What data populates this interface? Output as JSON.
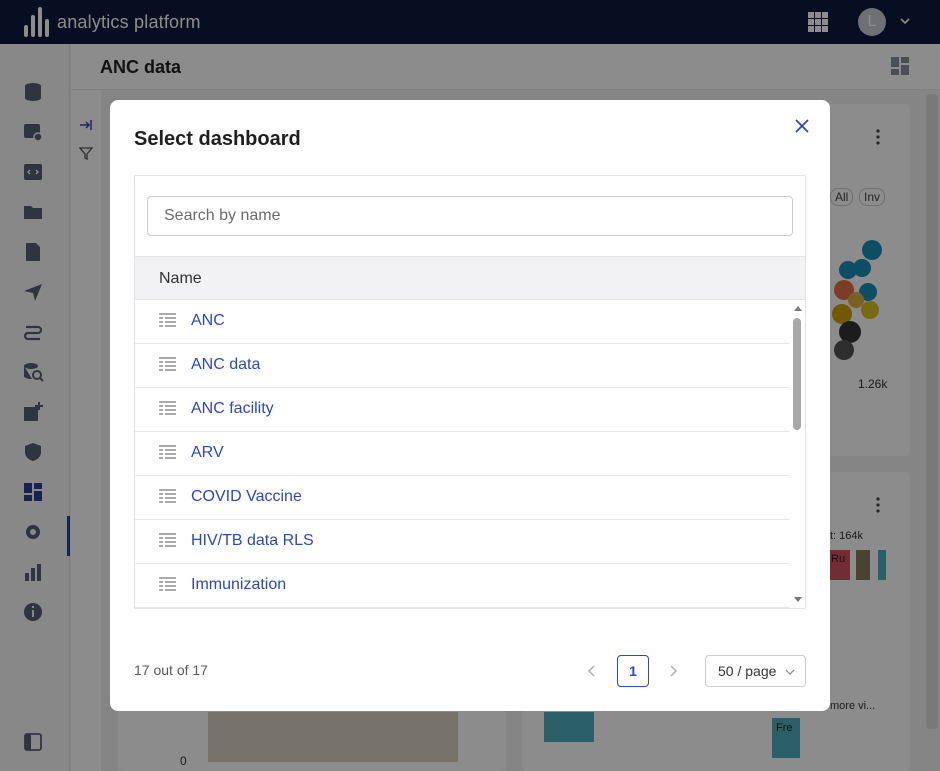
{
  "app": {
    "name": "analytics platform"
  },
  "user": {
    "initial": "L"
  },
  "page": {
    "title": "ANC data"
  },
  "modal": {
    "title": "Select dashboard",
    "search_placeholder": "Search by name",
    "column_name": "Name",
    "items": [
      {
        "label": "ANC"
      },
      {
        "label": "ANC data"
      },
      {
        "label": "ANC facility"
      },
      {
        "label": "ARV"
      },
      {
        "label": "COVID Vaccine"
      },
      {
        "label": "HIV/TB data RLS"
      },
      {
        "label": "Immunization"
      }
    ],
    "count_text": "17 out of 17",
    "current_page": "1",
    "page_size": "50 / page"
  },
  "background": {
    "chip_all": "All",
    "chip_inv": "Inv",
    "axis_value": "1.26k",
    "label_visit": "sit: 164k",
    "label_ru": "Ru",
    "label_fre": "Fre",
    "label_more": "more vi...",
    "axis_zero": "0"
  },
  "colors": {
    "accent": "#2d48b8",
    "topbar": "#0d1b3e"
  }
}
